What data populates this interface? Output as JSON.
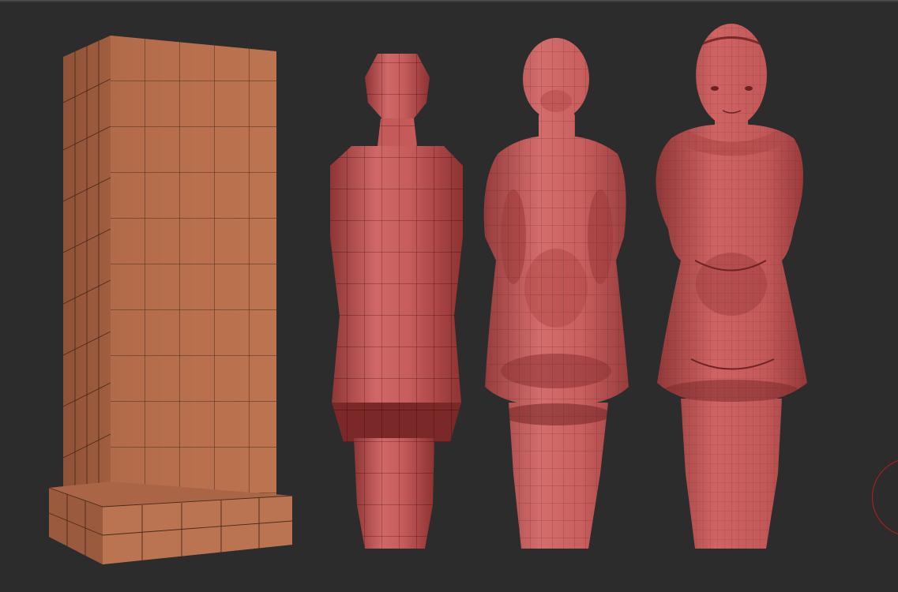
{
  "viewport": {
    "background": "#2c2c2c"
  },
  "models": [
    {
      "name": "base-block",
      "stage": "block-out",
      "color": "#b86f4f"
    },
    {
      "name": "low-poly-figure",
      "stage": "low-subdivision",
      "color": "#c55c5c"
    },
    {
      "name": "mid-poly-figure",
      "stage": "mid-subdivision",
      "color": "#c95c5c"
    },
    {
      "name": "high-poly-figure",
      "stage": "high-subdivision",
      "color": "#c65757"
    }
  ],
  "gizmo": {
    "icon": "view-rotation-gizmo-icon",
    "color": "#b02020"
  }
}
